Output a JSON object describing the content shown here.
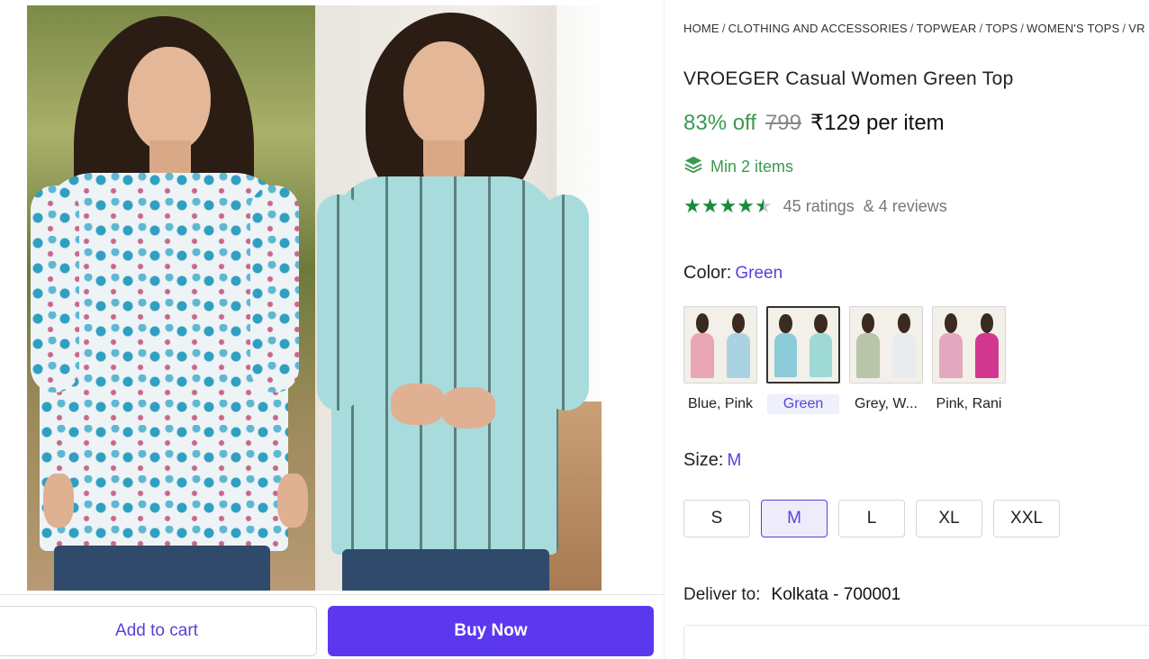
{
  "breadcrumb": {
    "items": [
      "HOME",
      "CLOTHING AND ACCESSORIES",
      "TOPWEAR",
      "TOPS",
      "WOMEN'S TOPS",
      "VR"
    ],
    "separator": "/"
  },
  "product": {
    "title": "VROEGER Casual Women Green Top",
    "discount": "83% off",
    "mrp": "799",
    "price": "₹129 per item",
    "min_order": "Min 2 items",
    "rating": 4.5,
    "ratings_text": "45 ratings",
    "reviews_text": "& 4 reviews"
  },
  "color": {
    "label": "Color:",
    "selected": "Green",
    "options": [
      {
        "label": "Blue, Pink",
        "selected": false,
        "colors": [
          "#e9a6b4",
          "#a9d3e3"
        ]
      },
      {
        "label": "Green",
        "selected": true,
        "colors": [
          "#8ccbd9",
          "#9fd9d6"
        ]
      },
      {
        "label": "Grey, W...",
        "selected": false,
        "colors": [
          "#b9c5a8",
          "#e8ecef"
        ]
      },
      {
        "label": "Pink, Rani",
        "selected": false,
        "colors": [
          "#e3a8bd",
          "#d1378e"
        ]
      }
    ]
  },
  "size": {
    "label": "Size:",
    "selected": "M",
    "options": [
      {
        "label": "S",
        "selected": false
      },
      {
        "label": "M",
        "selected": true
      },
      {
        "label": "L",
        "selected": false
      },
      {
        "label": "XL",
        "selected": false
      },
      {
        "label": "XXL",
        "selected": false
      }
    ]
  },
  "delivery": {
    "label": "Deliver to:",
    "location": "Kolkata - 700001"
  },
  "actions": {
    "add_to_cart": "Add to cart",
    "buy_now": "Buy Now"
  },
  "colors": {
    "accent": "#5b38ee",
    "discount_green": "#3a9a4e",
    "star_green": "#1a8a3c"
  },
  "icons": {
    "min_order": "stack-layers-icon",
    "rating": "star-icon"
  }
}
